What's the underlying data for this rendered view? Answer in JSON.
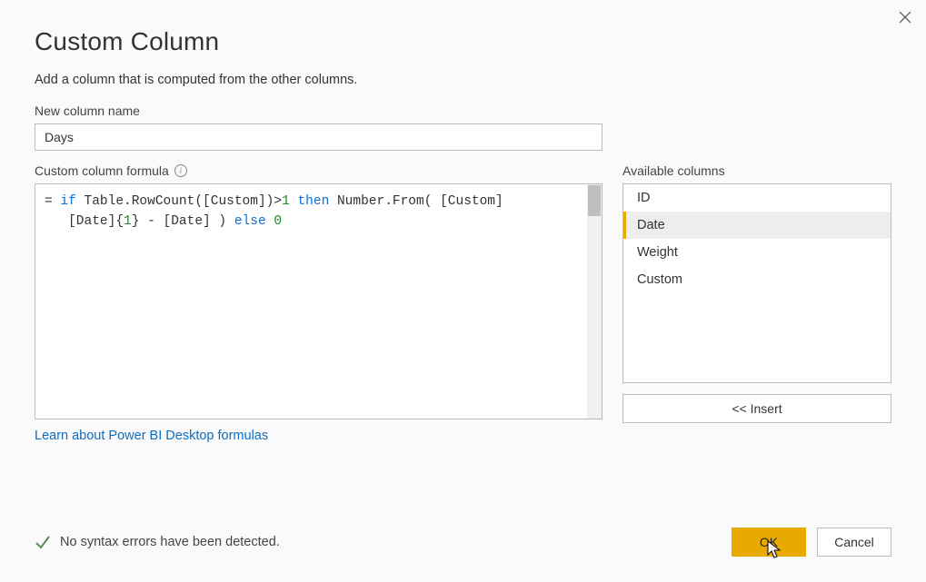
{
  "dialog": {
    "title": "Custom Column",
    "subtitle": "Add a column that is computed from the other columns."
  },
  "name_field": {
    "label": "New column name",
    "value": "Days"
  },
  "formula": {
    "label": "Custom column formula",
    "raw": "= if Table.RowCount([Custom])>1 then Number.From( [Custom]\n   [Date]{1} - [Date] ) else 0",
    "tokens": [
      {
        "t": "= "
      },
      {
        "t": "if",
        "c": "kw"
      },
      {
        "t": " Table.RowCount([Custom])>"
      },
      {
        "t": "1",
        "c": "lit"
      },
      {
        "t": " "
      },
      {
        "t": "then",
        "c": "kw"
      },
      {
        "t": " Number.From( [Custom]\n   [Date]{"
      },
      {
        "t": "1",
        "c": "lit"
      },
      {
        "t": "} - [Date] ) "
      },
      {
        "t": "else",
        "c": "kw"
      },
      {
        "t": " "
      },
      {
        "t": "0",
        "c": "lit"
      }
    ],
    "learn_link": "Learn about Power BI Desktop formulas"
  },
  "available": {
    "label": "Available columns",
    "items": [
      {
        "label": "ID",
        "selected": false
      },
      {
        "label": "Date",
        "selected": true
      },
      {
        "label": "Weight",
        "selected": false
      },
      {
        "label": "Custom",
        "selected": false
      }
    ],
    "insert_label": "<< Insert"
  },
  "status": {
    "text": "No syntax errors have been detected."
  },
  "buttons": {
    "ok": "OK",
    "cancel": "Cancel"
  }
}
